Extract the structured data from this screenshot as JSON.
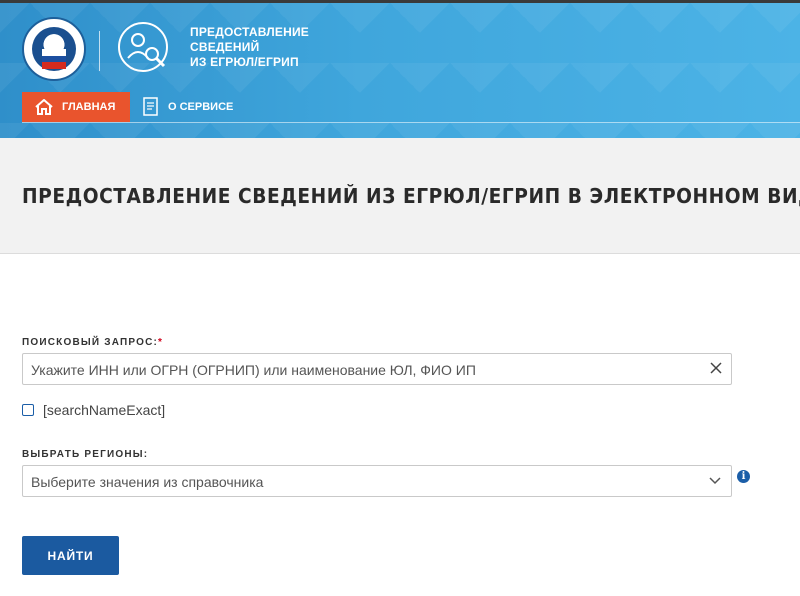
{
  "header": {
    "logo_title_lines": [
      "ПРЕДОСТАВЛЕНИЕ",
      "СВЕДЕНИЙ",
      "ИЗ ЕГРЮЛ/ЕГРИП"
    ],
    "emblem_icon": "fns-emblem-icon",
    "service_icon": "service-worker-icon"
  },
  "nav": {
    "home_label": "ГЛАВНАЯ",
    "home_icon": "home-icon",
    "about_label": "О СЕРВИСЕ",
    "about_icon": "document-icon"
  },
  "page": {
    "title": "ПРЕДОСТАВЛЕНИЕ СВЕДЕНИЙ ИЗ ЕГРЮЛ/ЕГРИП В ЭЛЕКТРОННОМ ВИДЕ"
  },
  "form": {
    "query_label": "ПОИСКОВЫЙ ЗАПРОС:",
    "query_required_mark": "*",
    "query_placeholder": "Укажите ИНН или ОГРН (ОГРНИП) или наименование ЮЛ, ФИО ИП",
    "exact_checkbox_label": "[searchNameExact]",
    "exact_checked": false,
    "regions_label": "ВЫБРАТЬ РЕГИОНЫ:",
    "regions_placeholder": "Выберите значения из справочника",
    "info_glyph": "i",
    "submit_label": "НАЙТИ"
  },
  "colors": {
    "header_blue": "#3fa6dc",
    "accent_orange": "#e9542d",
    "button_blue": "#1b5aa0",
    "required_red": "#d0021b"
  }
}
